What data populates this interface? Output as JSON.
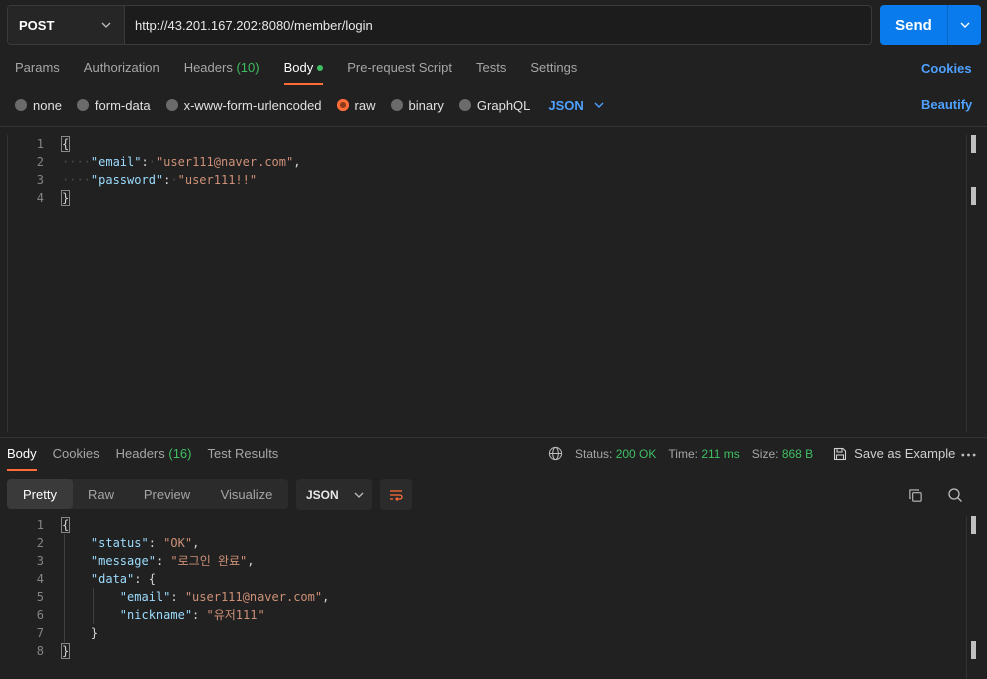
{
  "request": {
    "method": "POST",
    "url": "http://43.201.167.202:8080/member/login",
    "send_label": "Send"
  },
  "req_tabs": [
    {
      "label": "Params"
    },
    {
      "label": "Authorization"
    },
    {
      "label": "Headers",
      "count": "(10)"
    },
    {
      "label": "Body",
      "active": true
    },
    {
      "label": "Pre-request Script"
    },
    {
      "label": "Tests"
    },
    {
      "label": "Settings"
    }
  ],
  "cookies_label": "Cookies",
  "body_types": [
    {
      "label": "none"
    },
    {
      "label": "form-data"
    },
    {
      "label": "x-www-form-urlencoded"
    },
    {
      "label": "raw",
      "selected": true
    },
    {
      "label": "binary"
    },
    {
      "label": "GraphQL"
    }
  ],
  "body_format": "JSON",
  "beautify_label": "Beautify",
  "request_body_lines": [
    "1",
    "2",
    "3",
    "4"
  ],
  "request_body": {
    "email_key": "\"email\"",
    "email_val": "\"user111@naver.com\"",
    "password_key": "\"password\"",
    "password_val": "\"user111!!\""
  },
  "resp_tabs": [
    {
      "label": "Body",
      "active": true
    },
    {
      "label": "Cookies"
    },
    {
      "label": "Headers",
      "count": "(16)"
    },
    {
      "label": "Test Results"
    }
  ],
  "resp_meta": {
    "status_label": "Status:",
    "status_value": "200 OK",
    "time_label": "Time:",
    "time_value": "211 ms",
    "size_label": "Size:",
    "size_value": "868 B",
    "save_example": "Save as Example"
  },
  "view_modes": [
    "Pretty",
    "Raw",
    "Preview",
    "Visualize"
  ],
  "response_format": "JSON",
  "response_body_lines": [
    "1",
    "2",
    "3",
    "4",
    "5",
    "6",
    "7",
    "8"
  ],
  "response_body": {
    "status_key": "\"status\"",
    "status_val": "\"OK\"",
    "message_key": "\"message\"",
    "message_val": "\"로그인 완료\"",
    "data_key": "\"data\"",
    "email_key": "\"email\"",
    "email_val": "\"user111@naver.com\"",
    "nickname_key": "\"nickname\"",
    "nickname_val": "\"유저111\""
  },
  "colors": {
    "accent": "#ff6c37",
    "send": "#097bed",
    "link": "#4ea1ff",
    "success": "#3fbf62",
    "json_key": "#9cdcfe",
    "json_string": "#ce9178"
  },
  "icons": [
    "chevron-down-icon",
    "globe-icon",
    "save-icon",
    "more-icon",
    "wrap-lines-icon",
    "copy-icon",
    "search-icon"
  ]
}
